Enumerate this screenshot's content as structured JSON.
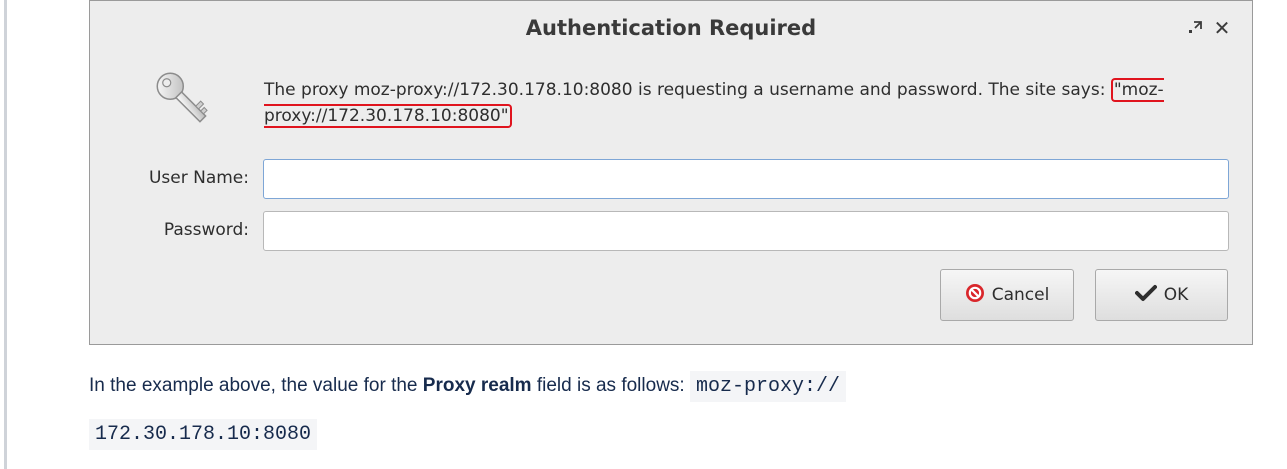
{
  "dialog": {
    "title": "Authentication Required",
    "message_prefix": "The proxy moz-proxy://172.30.178.10:8080 is requesting a username and password. The site says: ",
    "realm_quoted": "\"moz-proxy://172.30.178.10:8080\"",
    "username_label": "User Name:",
    "username_value": "",
    "password_label": "Password:",
    "password_value": "",
    "cancel_label": "Cancel",
    "ok_label": "OK",
    "icons": {
      "key": "key-icon",
      "maximize": "maximize-icon",
      "close": "close-icon",
      "cancel": "cancel-icon",
      "ok": "checkmark-icon"
    },
    "colors": {
      "highlight": "#e0141e",
      "cancel_icon": "#d9262b"
    }
  },
  "caption": {
    "prefix": "In the example above, the value for the ",
    "field_name": "Proxy realm",
    "middle": " field is as follows: ",
    "code_line1": "moz-proxy://",
    "code_line2": "172.30.178.10:8080"
  }
}
